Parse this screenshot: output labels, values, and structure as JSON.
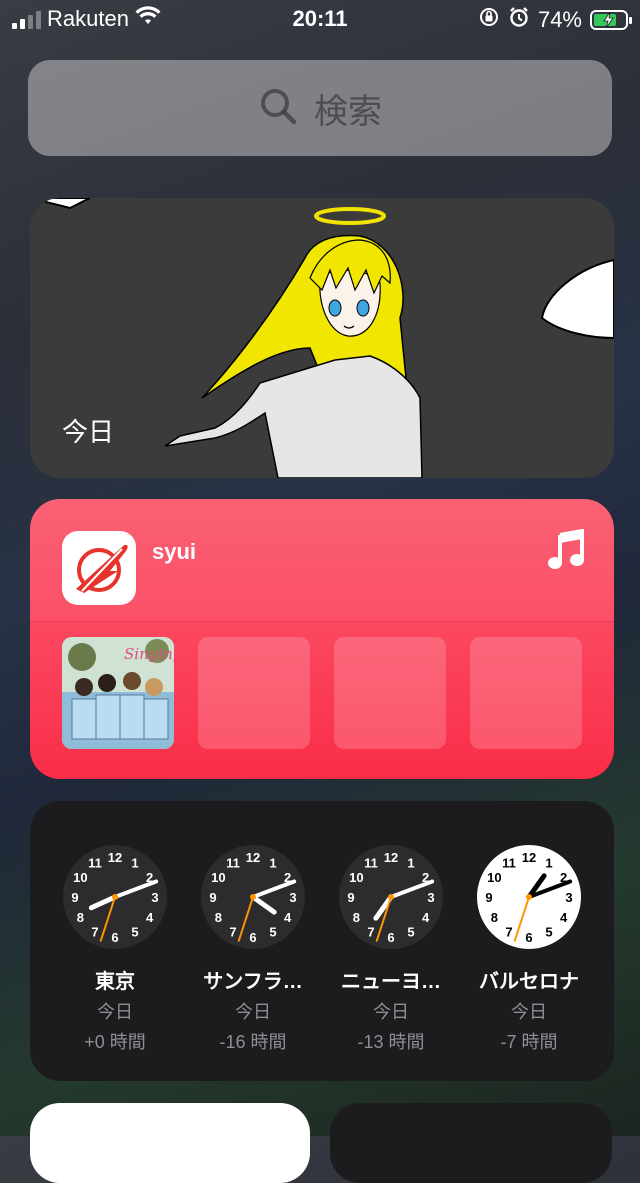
{
  "status_bar": {
    "carrier": "Rakuten",
    "time": "20:11",
    "battery_percent": "74%",
    "battery_level": 0.74,
    "icons": [
      "signal-icon",
      "wifi-icon",
      "rotation-lock-icon",
      "alarm-icon",
      "battery-charging-icon"
    ]
  },
  "search": {
    "placeholder": "検索",
    "icon": "search-icon"
  },
  "photo_widget": {
    "caption": "今日"
  },
  "music_widget": {
    "user": "syui",
    "icon": "music-note-icon",
    "album_art_title": "Singing!",
    "colors": {
      "accent": "#fa2d48"
    }
  },
  "world_clock": {
    "clocks": [
      {
        "city": "東京",
        "day": "今日",
        "offset": "+0 時間",
        "hour": 20,
        "minute": 11,
        "second": 33,
        "dark": true
      },
      {
        "city": "サンフラ…",
        "day": "今日",
        "offset": "-16 時間",
        "hour": 4,
        "minute": 11,
        "second": 33,
        "dark": true
      },
      {
        "city": "ニューヨ…",
        "day": "今日",
        "offset": "-13 時間",
        "hour": 7,
        "minute": 11,
        "second": 33,
        "dark": true
      },
      {
        "city": "バルセロナ",
        "day": "今日",
        "offset": "-7 時間",
        "hour": 13,
        "minute": 11,
        "second": 33,
        "dark": false
      }
    ]
  }
}
